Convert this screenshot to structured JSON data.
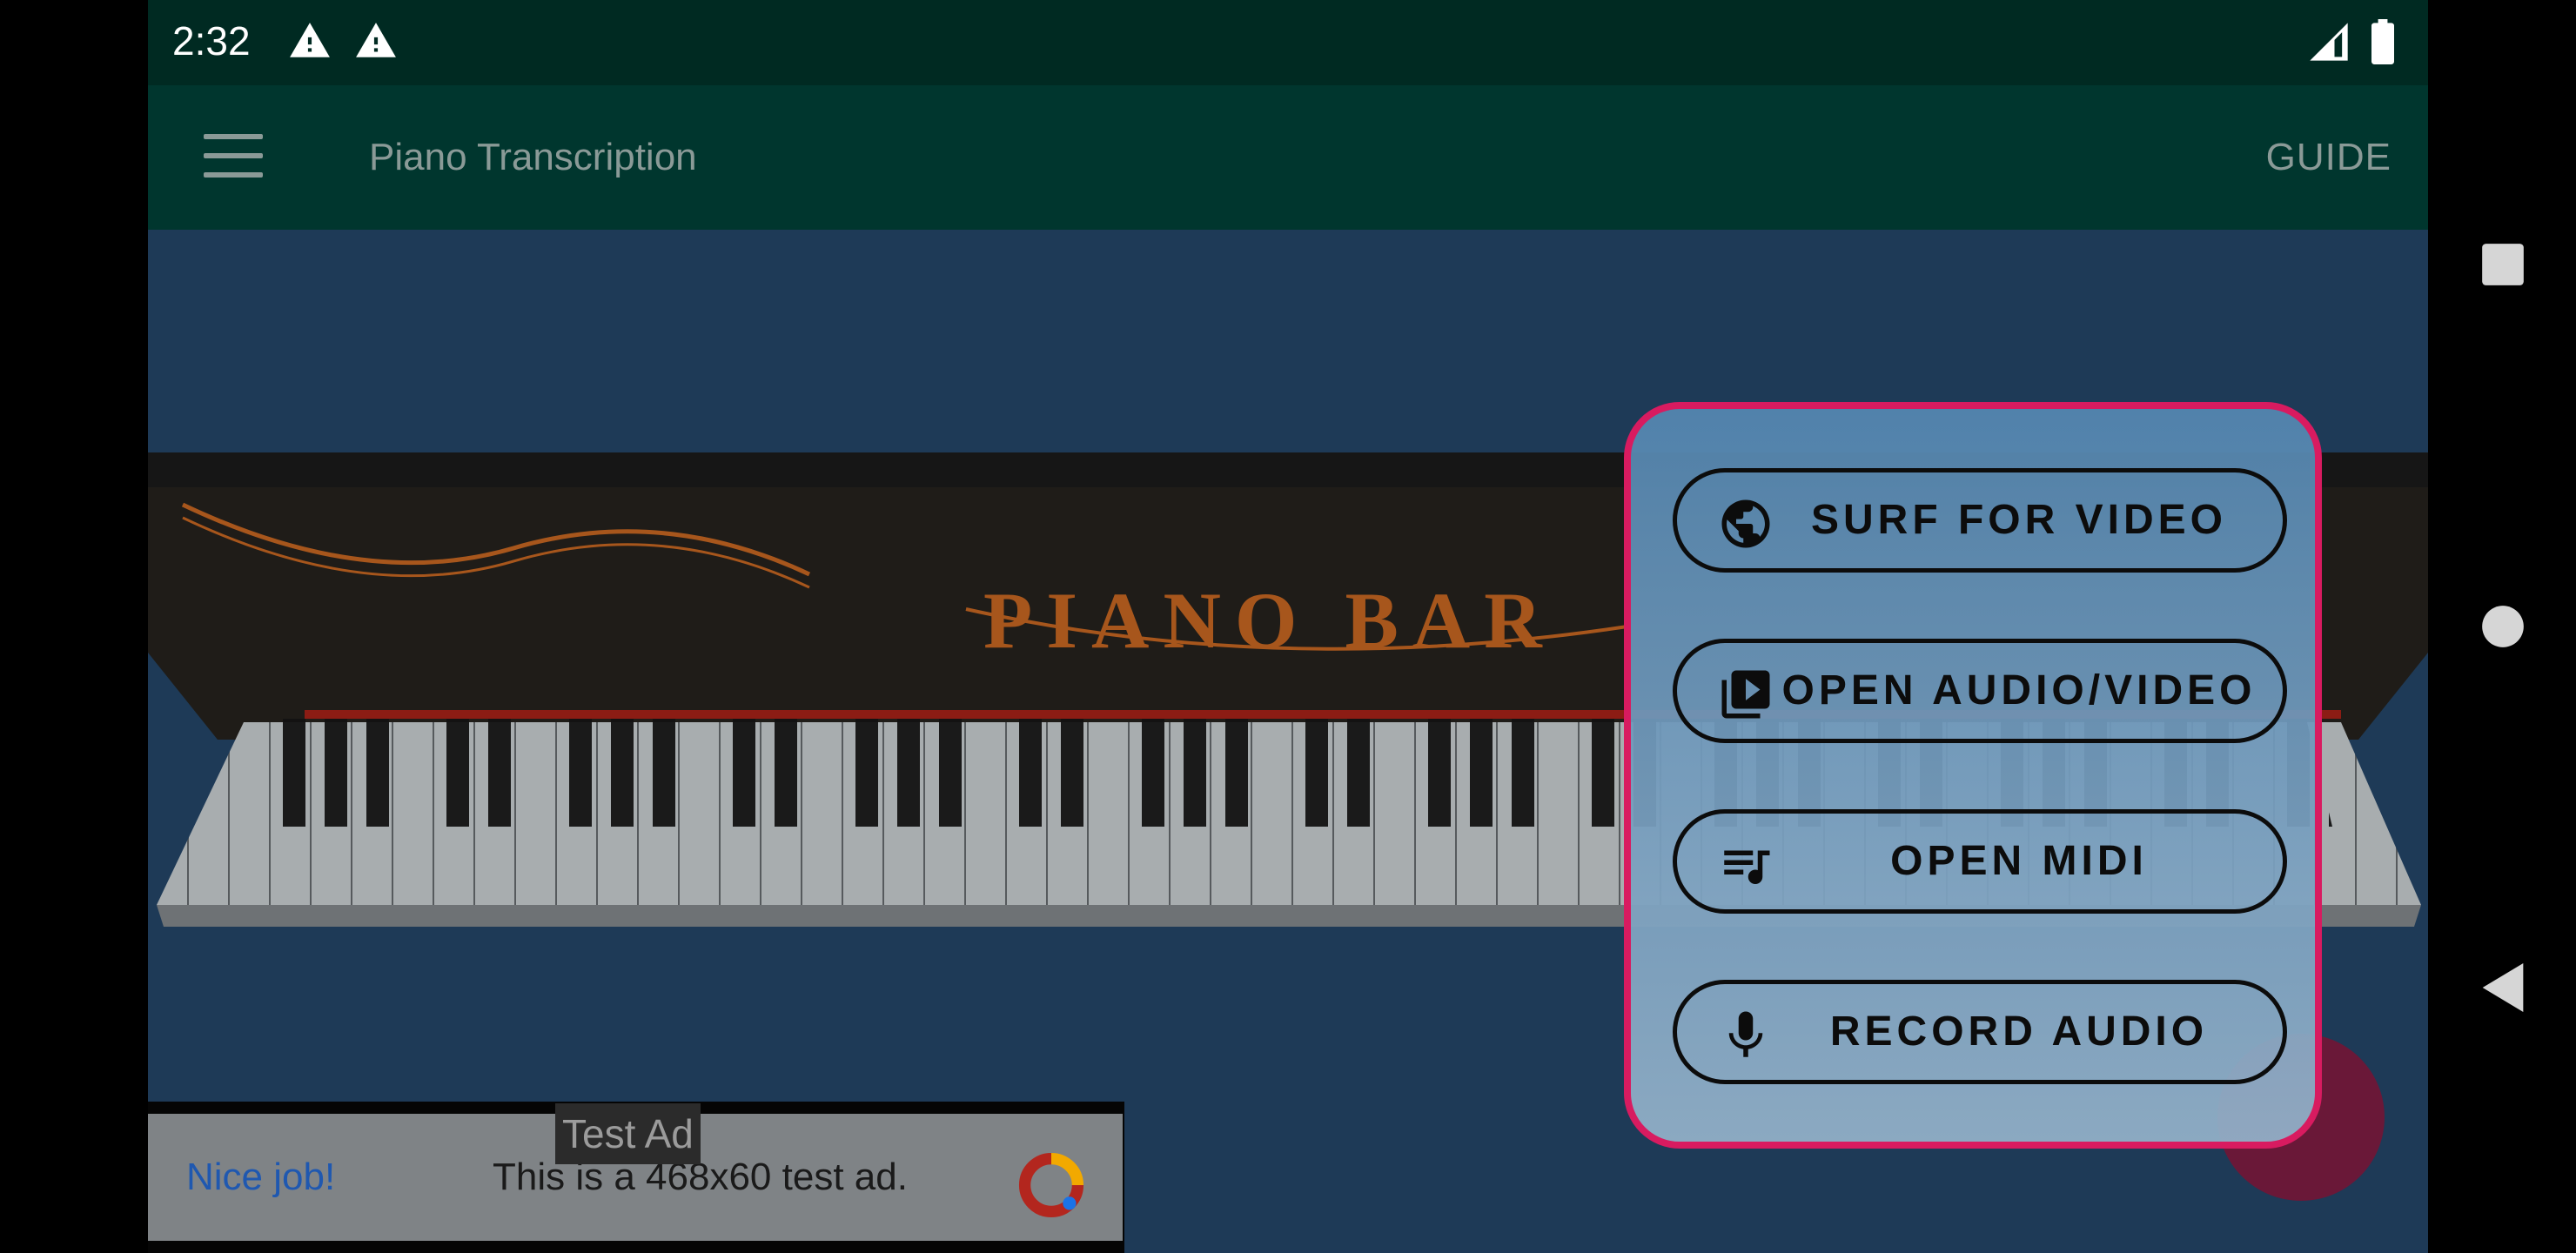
{
  "status_bar": {
    "time": "2:32"
  },
  "app_bar": {
    "title": "Piano Transcription",
    "guide_label": "GUIDE"
  },
  "piano": {
    "brand": "PIANO BAR"
  },
  "menu": {
    "items": [
      {
        "label": "SURF FOR VIDEO",
        "icon": "globe-icon"
      },
      {
        "label": "OPEN AUDIO/VIDEO",
        "icon": "video-library-icon"
      },
      {
        "label": "OPEN MIDI",
        "icon": "playlist-music-icon"
      },
      {
        "label": "RECORD AUDIO",
        "icon": "microphone-icon"
      }
    ],
    "accent_color": "#d81b60"
  },
  "ad": {
    "label": "Test Ad",
    "headline": "Nice job!",
    "body": "This is a 468x60 test ad."
  },
  "colors": {
    "app_bar": "#00362e",
    "status_bar": "#002a22",
    "background": "#1e3a57"
  }
}
